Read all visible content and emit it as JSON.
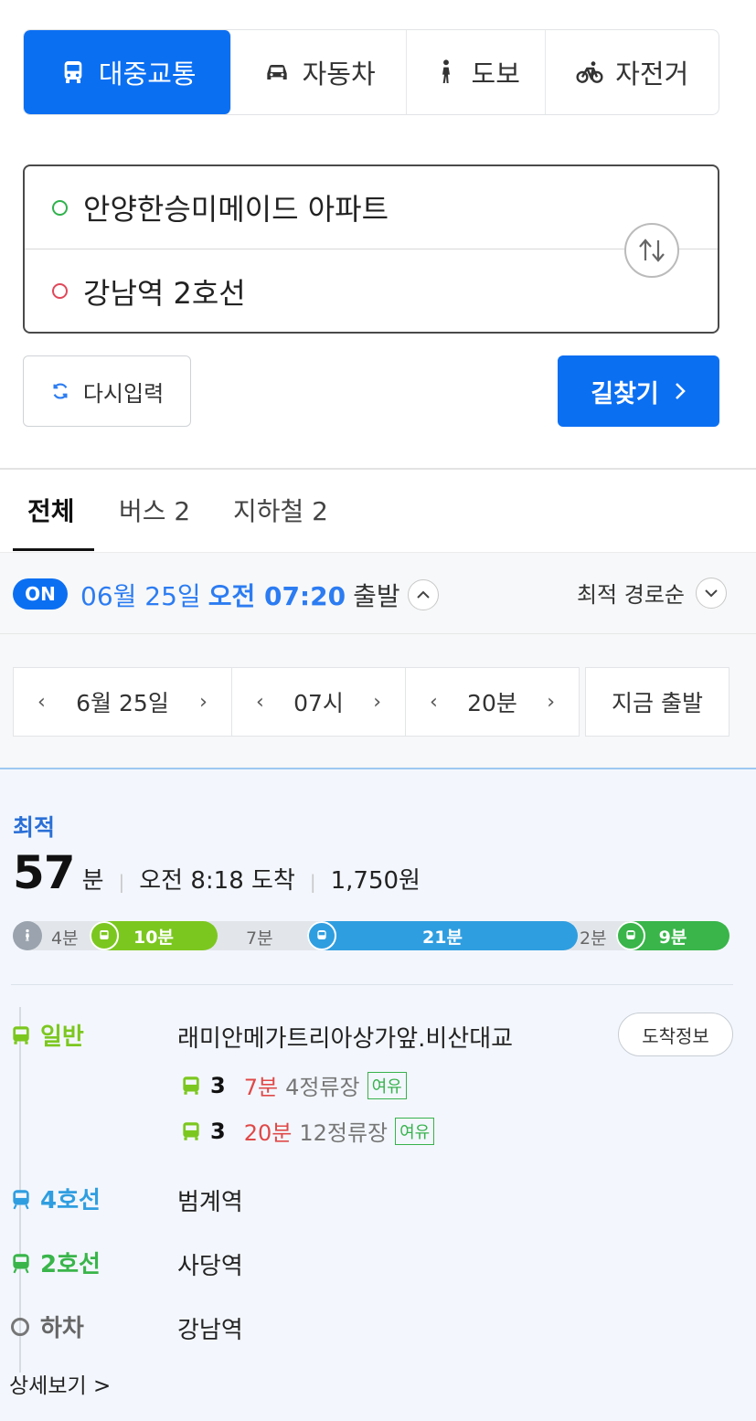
{
  "modes": [
    {
      "label": "대중교통",
      "icon": "bus-icon",
      "active": true
    },
    {
      "label": "자동차",
      "icon": "car-icon",
      "active": false
    },
    {
      "label": "도보",
      "icon": "walk-icon",
      "active": false
    },
    {
      "label": "자전거",
      "icon": "bike-icon",
      "active": false
    }
  ],
  "route": {
    "origin": "안양한승미메이드 아파트",
    "destination": "강남역 2호선"
  },
  "actions": {
    "reset_label": "다시입력",
    "search_label": "길찾기"
  },
  "filter_tabs": [
    "전체",
    "버스 2",
    "지하철 2"
  ],
  "departure": {
    "badge": "ON",
    "date": "06월 25일",
    "ampm_time": "오전 07:20",
    "suffix": "출발",
    "sort": "최적 경로순"
  },
  "pickers": {
    "date": "6월 25일",
    "hour": "07시",
    "minute": "20분",
    "now": "지금 출발"
  },
  "result": {
    "tag": "최적",
    "total_min": "57",
    "total_unit": "분",
    "arrival": "오전 8:18 도착",
    "fare": "1,750원",
    "timeline": [
      {
        "type": "walk",
        "label": "4분"
      },
      {
        "type": "bus",
        "label": "10분",
        "color": "#7cc71f"
      },
      {
        "type": "walk",
        "label": "7분"
      },
      {
        "type": "subway4",
        "label": "21분",
        "color": "#2f9ee0"
      },
      {
        "type": "walk",
        "label": "2분"
      },
      {
        "type": "subway2",
        "label": "9분",
        "color": "#39b54a"
      }
    ],
    "steps": [
      {
        "mode": "일반",
        "color": "#7cc71f",
        "name": "래미안메가트리아상가앞.비산대교"
      },
      {
        "mode": "4호선",
        "color": "#2f9ee0",
        "name": "범계역"
      },
      {
        "mode": "2호선",
        "color": "#39b54a",
        "name": "사당역"
      },
      {
        "mode": "하차",
        "color": "#666666",
        "name": "강남역"
      }
    ],
    "arrive_info": "도착정보",
    "buses": [
      {
        "no": "3",
        "min": "7분",
        "stops": "4정류장",
        "crowd": "여유"
      },
      {
        "no": "3",
        "min": "20분",
        "stops": "12정류장",
        "crowd": "여유"
      }
    ],
    "detail": "상세보기 >"
  },
  "colors": {
    "accent": "#0b6ff2",
    "bus_green": "#7cc71f",
    "line4": "#2f9ee0",
    "line2": "#39b54a",
    "late_red": "#e04848"
  }
}
